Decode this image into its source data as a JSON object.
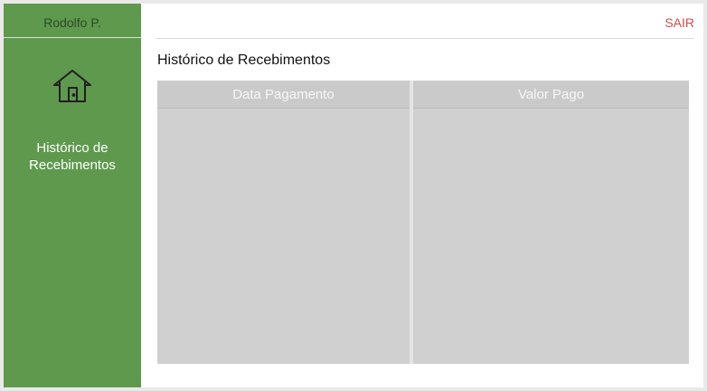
{
  "sidebar": {
    "user_name": "Rodolfo P.",
    "home_icon": "home-icon",
    "items": [
      {
        "label": "Histórico de Recebimentos"
      }
    ],
    "background_color": "#5e994e"
  },
  "header": {
    "logout_label": "SAIR",
    "logout_color": "#d24c4c"
  },
  "main": {
    "title": "Histórico de Recebimentos",
    "table": {
      "columns": [
        "Data Pagamento",
        "Valor Pago"
      ],
      "rows": []
    }
  }
}
